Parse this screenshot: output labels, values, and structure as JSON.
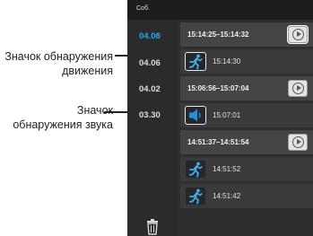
{
  "callouts": {
    "motion": [
      "Значок обнаружения",
      "движения"
    ],
    "sound": [
      "Значок",
      "обнаружения звука"
    ]
  },
  "app": {
    "top_label": "Соб."
  },
  "dates": [
    "04.08",
    "04.06",
    "04.02",
    "03.30"
  ],
  "selected_date": "04.08",
  "events": [
    {
      "kind": "range",
      "time": "15:14:25–15:14:32",
      "has_play": true
    },
    {
      "kind": "item",
      "icon": "motion-detection-icon",
      "time": "15:14:30"
    },
    {
      "kind": "range",
      "time": "15:06:56–15:07:04",
      "has_play": true
    },
    {
      "kind": "item",
      "icon": "sound-detection-icon",
      "time": "15:07:01"
    },
    {
      "kind": "range",
      "time": "14:51:37–14:51:54",
      "has_play": true
    },
    {
      "kind": "item",
      "icon": "motion-detection-icon",
      "time": "14:51:52"
    },
    {
      "kind": "item",
      "icon": "motion-detection-icon",
      "time": "14:51:42"
    }
  ],
  "colors": {
    "accent": "#22a8e8",
    "background": "#2e2e2e",
    "motion_icon": "#3fb0ef",
    "sound_icon": "#1e93e0"
  },
  "icons": {
    "delete": "trash-icon",
    "play": "play-icon"
  }
}
